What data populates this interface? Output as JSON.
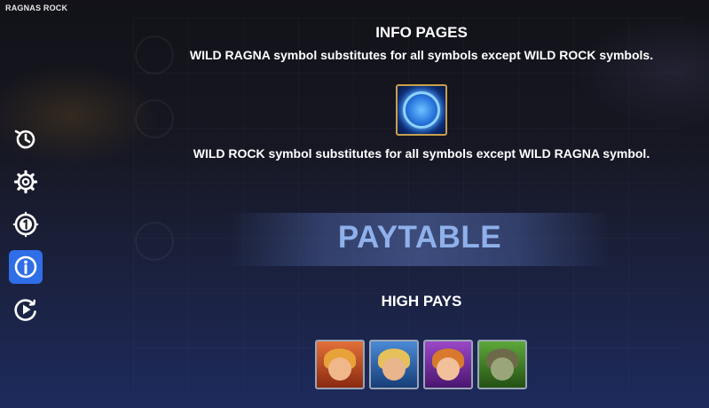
{
  "app": {
    "title": "RAGNAS ROCK"
  },
  "sidebar": {
    "items": [
      {
        "icon": "history-icon",
        "active": false
      },
      {
        "icon": "gear-icon",
        "active": false
      },
      {
        "icon": "bet-one-icon",
        "active": false
      },
      {
        "icon": "info-icon",
        "active": true
      },
      {
        "icon": "autoplay-icon",
        "active": false
      }
    ]
  },
  "info": {
    "title": "INFO PAGES",
    "wild_ragna_text": "WILD RAGNA symbol substitutes for all symbols except WILD ROCK symbols.",
    "wild_symbol_icon": "wild-rock-symbol",
    "wild_rock_text": "WILD ROCK symbol substitutes for all symbols except WILD RAGNA symbol."
  },
  "paytable": {
    "title": "PAYTABLE",
    "high_pays_label": "HIGH PAYS",
    "symbols": [
      {
        "icon": "red-dwarf-symbol",
        "color": "#c8501e"
      },
      {
        "icon": "blonde-warrior-symbol",
        "color": "#2d6fb8"
      },
      {
        "icon": "valkyrie-symbol",
        "color": "#7a2fa8"
      },
      {
        "icon": "green-troll-symbol",
        "color": "#3d8a2a"
      }
    ]
  },
  "colors": {
    "accent": "#2f6ee6",
    "paytable_text": "#8fb0ea",
    "symbol_border": "#9aa6b6"
  }
}
